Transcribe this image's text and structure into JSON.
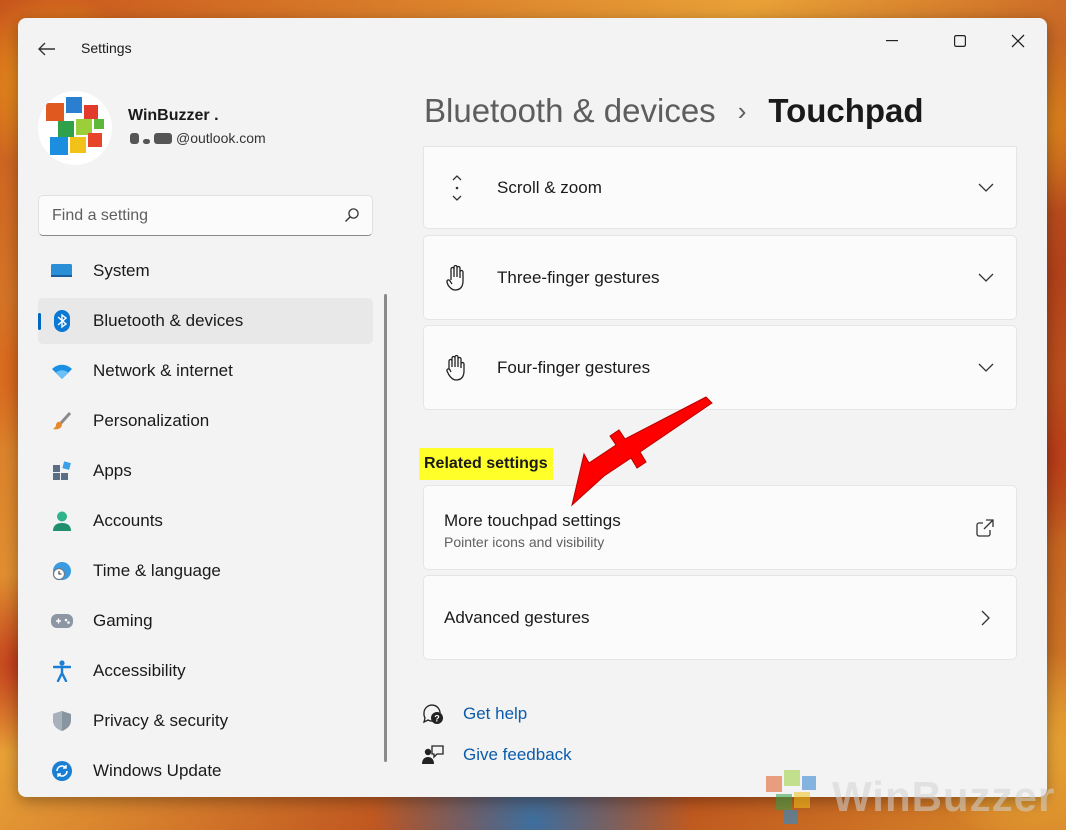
{
  "window": {
    "title": "Settings"
  },
  "user": {
    "name": "WinBuzzer .",
    "email_domain": "@outlook.com"
  },
  "search": {
    "placeholder": "Find a setting"
  },
  "nav": {
    "items": [
      {
        "label": "System",
        "icon": "monitor-icon",
        "active": false
      },
      {
        "label": "Bluetooth & devices",
        "icon": "bluetooth-icon",
        "active": true
      },
      {
        "label": "Network & internet",
        "icon": "wifi-icon",
        "active": false
      },
      {
        "label": "Personalization",
        "icon": "brush-icon",
        "active": false
      },
      {
        "label": "Apps",
        "icon": "apps-icon",
        "active": false
      },
      {
        "label": "Accounts",
        "icon": "person-icon",
        "active": false
      },
      {
        "label": "Time & language",
        "icon": "globe-clock-icon",
        "active": false
      },
      {
        "label": "Gaming",
        "icon": "gamepad-icon",
        "active": false
      },
      {
        "label": "Accessibility",
        "icon": "accessibility-icon",
        "active": false
      },
      {
        "label": "Privacy & security",
        "icon": "shield-icon",
        "active": false
      },
      {
        "label": "Windows Update",
        "icon": "update-icon",
        "active": false
      }
    ]
  },
  "breadcrumb": {
    "parent": "Bluetooth & devices",
    "separator": "›",
    "current": "Touchpad"
  },
  "sections": {
    "scroll_zoom": "Scroll & zoom",
    "three_finger": "Three-finger gestures",
    "four_finger": "Four-finger gestures"
  },
  "related": {
    "title": "Related settings",
    "more_touchpad": {
      "title": "More touchpad settings",
      "subtitle": "Pointer icons and visibility"
    },
    "advanced_gestures": "Advanced gestures"
  },
  "footer": {
    "get_help": "Get help",
    "give_feedback": "Give feedback"
  },
  "watermark": "WinBuzzer",
  "colors": {
    "accent": "#0067c0",
    "highlight": "#ffff2a",
    "arrow": "#ff0000",
    "link": "#0b5cad"
  }
}
